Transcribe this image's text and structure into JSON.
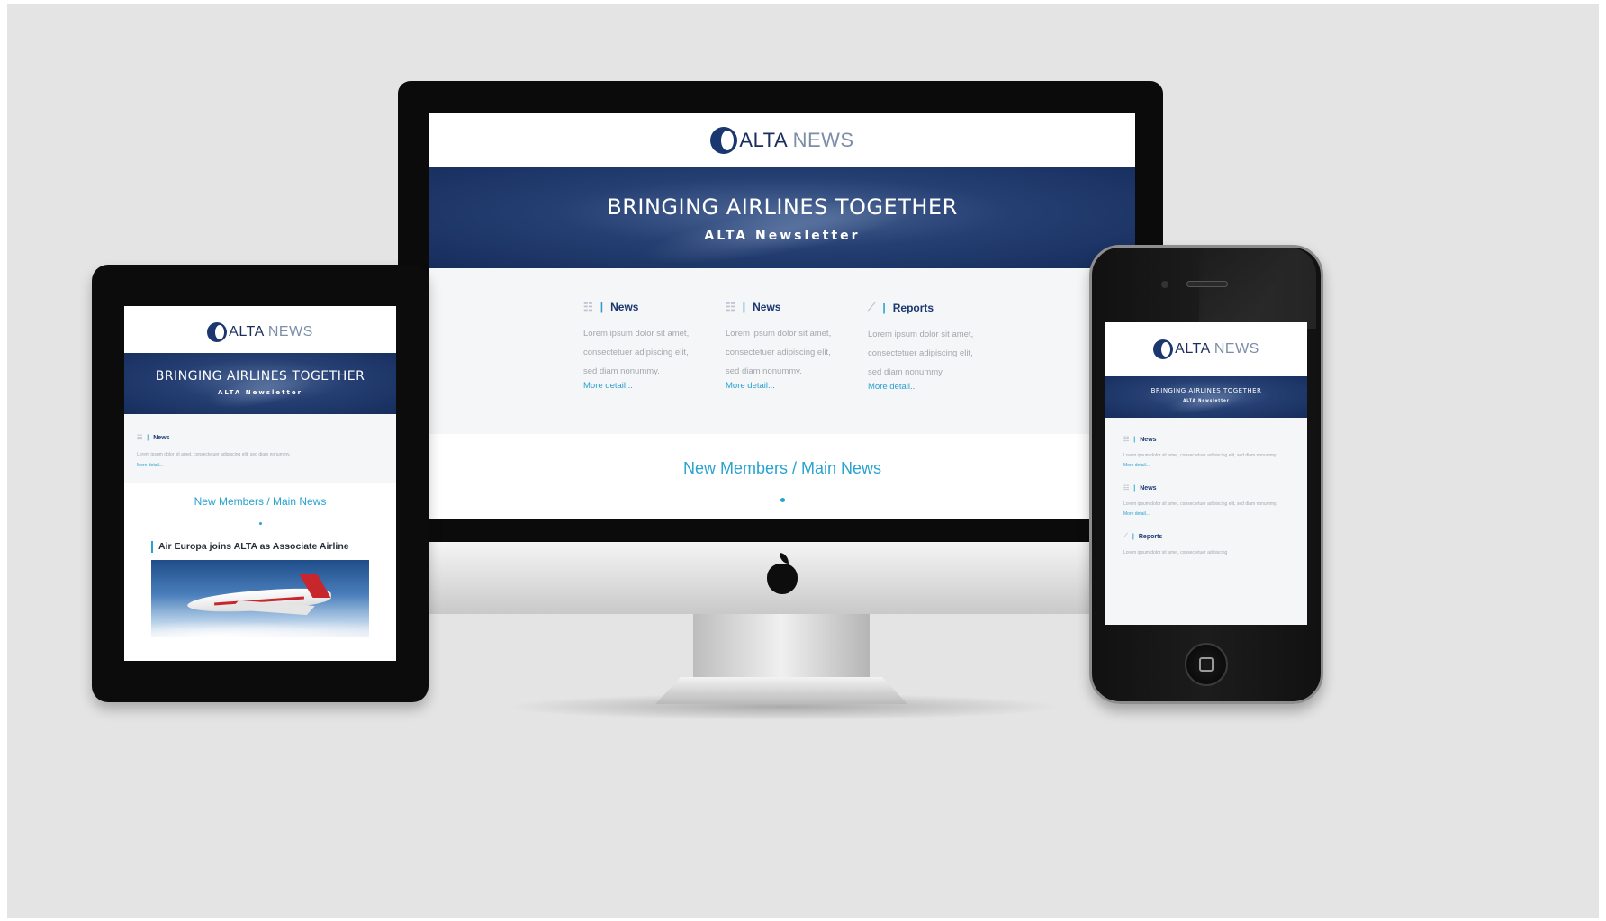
{
  "logo": {
    "brand": "ALTA",
    "suffix": " NEWS"
  },
  "banner": {
    "title": "BRINGING AIRLINES TOGETHER",
    "subtitle": "ALTA Newsletter"
  },
  "sections": [
    {
      "icon": "list-icon",
      "label": "News",
      "text_desktop": "Lorem ipsum dolor sit amet, consectetuer adipiscing elit, sed diam nonummy.",
      "text_tablet": "Lorem ipsum dolor sit amet, consectetuer adipiscing elit, sed diam nonummy.",
      "more": "More detail..."
    },
    {
      "icon": "list-icon",
      "label": "News",
      "text_desktop": "Lorem ipsum dolor sit amet, consectetuer adipiscing elit, sed diam nonummy.",
      "more": "More detail..."
    },
    {
      "icon": "chart-icon",
      "label": "Reports",
      "text_desktop": "Lorem ipsum dolor sit amet, consectetuer adipiscing elit, sed diam nonummy.",
      "text_phone": "Lorem ipsum dolor sit amet, consectetuer adipiscing",
      "more": "More detail..."
    }
  ],
  "main_section_title": "New Members / Main News",
  "article": {
    "title": "Air Europa joins ALTA as Associate Airline"
  },
  "colors": {
    "navy": "#1b3770",
    "accent": "#2a9fd0",
    "background": "#e4e4e4"
  }
}
